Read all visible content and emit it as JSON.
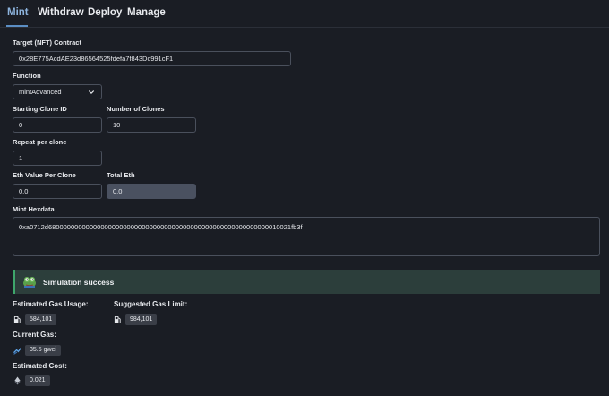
{
  "tabs": [
    {
      "label": "Mint"
    },
    {
      "label": "Withdraw"
    },
    {
      "label": "Deploy"
    },
    {
      "label": "Manage"
    }
  ],
  "form": {
    "target_contract": {
      "label": "Target (NFT) Contract",
      "value": "0x28E775AcdAE23d86564525fdefa7f843Dc991cF1"
    },
    "function": {
      "label": "Function",
      "value": "mintAdvanced"
    },
    "starting_clone_id": {
      "label": "Starting Clone ID",
      "value": "0"
    },
    "number_of_clones": {
      "label": "Number of Clones",
      "value": "10"
    },
    "repeat_per_clone": {
      "label": "Repeat per clone",
      "value": "1"
    },
    "eth_value_per_clone": {
      "label": "Eth Value Per Clone",
      "value": "0.0"
    },
    "total_eth": {
      "label": "Total Eth",
      "value": "0.0"
    },
    "mint_hexdata": {
      "label": "Mint Hexdata",
      "value": "0xa0712d68000000000000000000000000000000000000000000000000000000000010021fb3f"
    }
  },
  "simulation": {
    "status_text": "Simulation success",
    "status_color": "#3ea66b"
  },
  "stats": {
    "estimated_gas_usage": {
      "label": "Estimated Gas Usage:",
      "value": "584,101"
    },
    "suggested_gas_limit": {
      "label": "Suggested Gas Limit:",
      "value": "984,101"
    },
    "current_gas": {
      "label": "Current Gas:",
      "value": "35.5 gwei"
    },
    "estimated_cost": {
      "label": "Estimated Cost:",
      "value": "0.021"
    }
  },
  "icons": {
    "status": "frog-icon",
    "gas": "gas-pump-icon",
    "current_gas": "gas-trend-icon",
    "cost": "ethereum-icon",
    "select": "chevron-down-icon"
  }
}
